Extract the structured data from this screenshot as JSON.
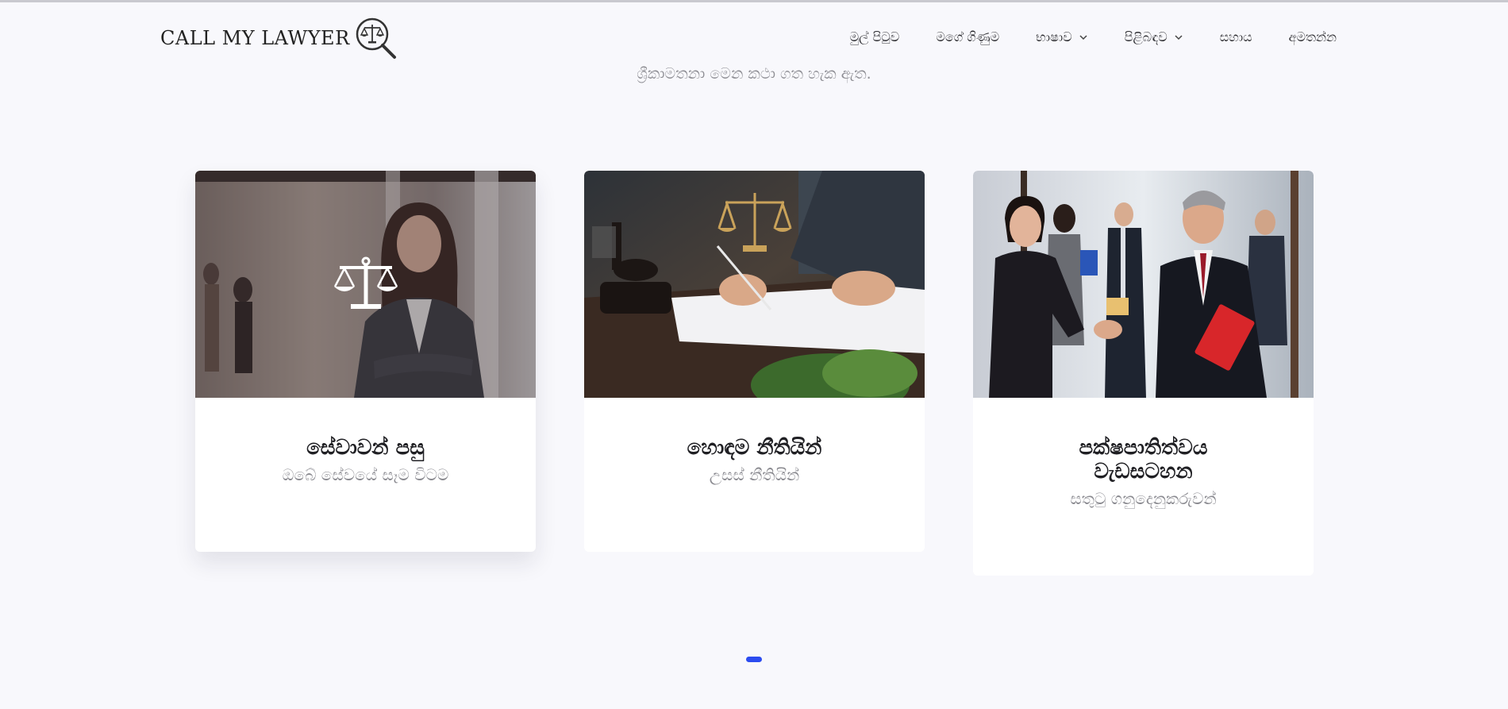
{
  "header": {
    "logo_text": "CALL MY LAWYER",
    "logo_icon": "scales-magnifier-icon",
    "nav": [
      {
        "label": "මුල් පිටුව",
        "has_dropdown": false
      },
      {
        "label": "මගේ ගිණුම",
        "has_dropdown": false
      },
      {
        "label": "භාෂාව",
        "has_dropdown": true
      },
      {
        "label": "පිළිබඳව",
        "has_dropdown": true
      },
      {
        "label": "සහාය",
        "has_dropdown": false
      },
      {
        "label": "අමතන්න",
        "has_dropdown": false
      }
    ]
  },
  "intro_partial": "ශ්‍රීකාමතනා මෙන කථා ගත හැක ඇත.",
  "cards": [
    {
      "title": "සේවාවන් පසු",
      "subtitle": "ඔබේ සේවයේ සෑම විටම",
      "image": "businesswoman-photo",
      "overlay_icon": "scales-icon"
    },
    {
      "title": "හොඳම නීතියින්",
      "subtitle": "උසස් නීතියින්",
      "image": "lawyer-signing-documents-photo"
    },
    {
      "title": "පක්ෂපාතිත්වය වැඩසටහන",
      "subtitle": "සතුටු ගනුදෙනුකරුවන්",
      "image": "lawyers-handshake-photo"
    }
  ],
  "carousel": {
    "pages": 1,
    "active": 1
  },
  "colors": {
    "accent": "#2c4cf0",
    "background": "#f8f8fc"
  }
}
